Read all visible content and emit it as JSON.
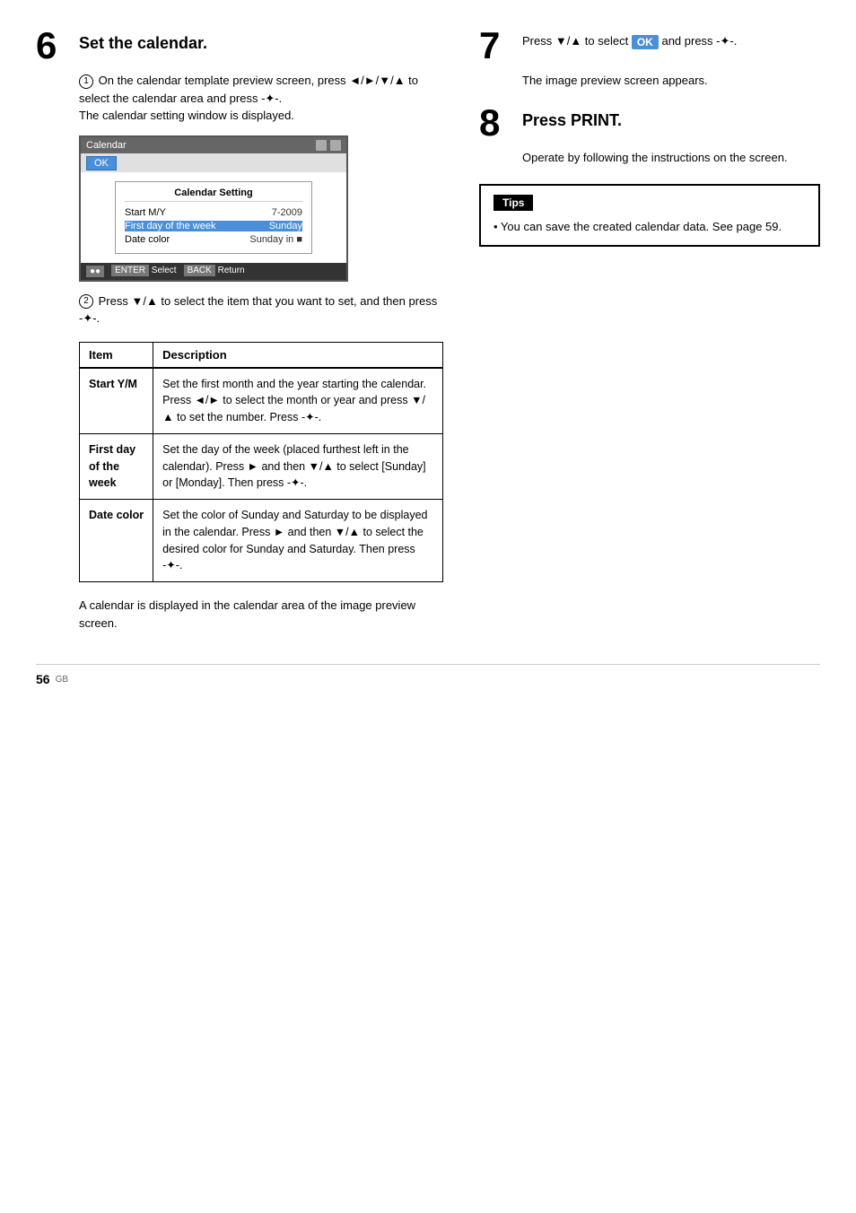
{
  "steps": {
    "step6": {
      "number": "6",
      "title": "Set the calendar.",
      "sub1_circle": "①",
      "sub1_text": "On the calendar template preview screen, press ◄/►/▼/▲ to select the calendar area and press -✦-.\nThe calendar setting window is displayed.",
      "sub2_circle": "②",
      "sub2_text": "Press ▼/▲ to select the item that you want to set, and then press -✦-.",
      "calendar_mockup": {
        "titlebar": "Calendar",
        "ok_label": "OK",
        "setting_title": "Calendar Setting",
        "rows": [
          {
            "label": "Start M/Y",
            "value": "7-2009",
            "selected": false
          },
          {
            "label": "First day of the week",
            "value": "Sunday",
            "selected": true
          },
          {
            "label": "Date color",
            "value": "Sunday in 🟦",
            "selected": false
          }
        ],
        "footer": "●● ENTER Select BACK Return"
      },
      "table": {
        "headers": [
          "Item",
          "Description"
        ],
        "rows": [
          {
            "item": "Start Y/M",
            "desc": "Set the first month and the year starting the calendar. Press ◄/► to select the month or year and press ▼/▲ to set the number. Press -✦-."
          },
          {
            "item": "First day\nof the\nweek",
            "desc": "Set the day of the week (placed furthest left in the calendar). Press ► and then ▼/▲ to select [Sunday] or [Monday]. Then press -✦-."
          },
          {
            "item": "Date color",
            "desc": "Set the color of Sunday and Saturday to be displayed in the calendar. Press ► and then ▼/▲ to select the desired color for Sunday and Saturday. Then press -✦-."
          }
        ]
      },
      "note": "A calendar is displayed in the calendar area of the image preview screen."
    },
    "step7": {
      "number": "7",
      "text": "Press ▼/▲ to select",
      "ok_label": "OK",
      "text2": "and press -✦-.",
      "sub": "The image preview screen appears."
    },
    "step8": {
      "number": "8",
      "title": "Press PRINT.",
      "sub": "Operate by following the instructions on the screen."
    },
    "tips": {
      "header": "Tips",
      "bullet": "• You can save the created calendar data. See page 59."
    }
  },
  "footer": {
    "page_number": "56",
    "locale": "GB"
  }
}
